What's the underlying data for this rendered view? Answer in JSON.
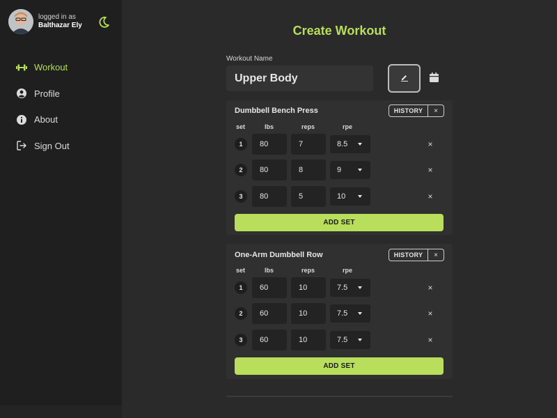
{
  "user": {
    "status_label": "logged in as",
    "name": "Balthazar Ely"
  },
  "nav": [
    {
      "label": "Workout",
      "icon": "dumbbell-icon",
      "active": true
    },
    {
      "label": "Profile",
      "icon": "user-circle-icon",
      "active": false
    },
    {
      "label": "About",
      "icon": "info-icon",
      "active": false
    },
    {
      "label": "Sign Out",
      "icon": "sign-out-icon",
      "active": false
    }
  ],
  "page": {
    "title": "Create Workout"
  },
  "workout_name": {
    "label": "Workout Name",
    "value": "Upper Body"
  },
  "columns": {
    "set": "set",
    "lbs": "lbs",
    "reps": "reps",
    "rpe": "rpe"
  },
  "exercises": [
    {
      "name": "Dumbbell Bench Press",
      "history_label": "HISTORY",
      "close_label": "×",
      "add_set_label": "ADD SET",
      "sets": [
        {
          "set": "1",
          "lbs": "80",
          "reps": "7",
          "rpe": "8.5"
        },
        {
          "set": "2",
          "lbs": "80",
          "reps": "8",
          "rpe": "9"
        },
        {
          "set": "3",
          "lbs": "80",
          "reps": "5",
          "rpe": "10"
        }
      ]
    },
    {
      "name": "One-Arm Dumbbell Row",
      "history_label": "HISTORY",
      "close_label": "×",
      "add_set_label": "ADD SET",
      "sets": [
        {
          "set": "1",
          "lbs": "60",
          "reps": "10",
          "rpe": "7.5"
        },
        {
          "set": "2",
          "lbs": "60",
          "reps": "10",
          "rpe": "7.5"
        },
        {
          "set": "3",
          "lbs": "60",
          "reps": "10",
          "rpe": "7.5"
        }
      ]
    }
  ],
  "row_remove_label": "×",
  "colors": {
    "accent": "#b8de5c",
    "sidebar_bg": "#1f1f1f",
    "main_bg": "#2a2a2a",
    "card_bg": "#303030"
  }
}
